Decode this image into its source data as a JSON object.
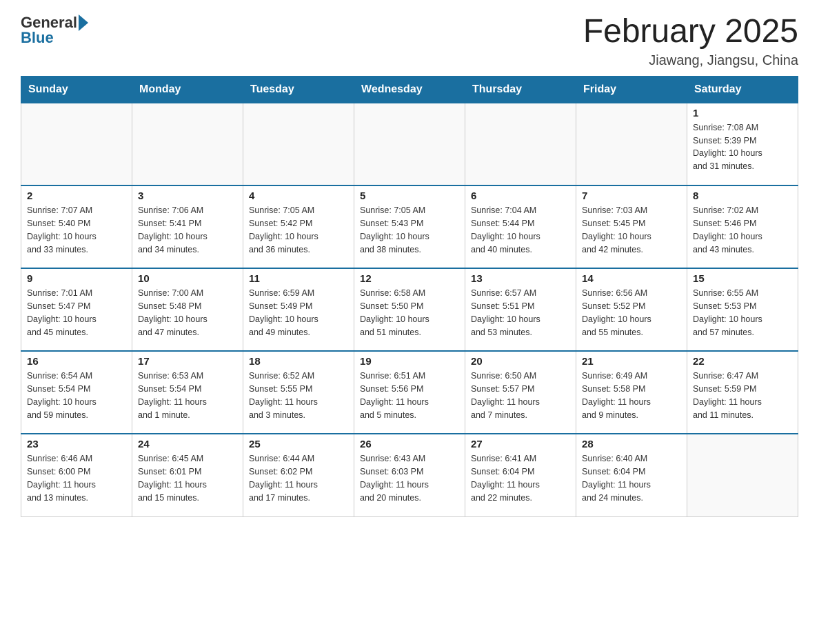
{
  "header": {
    "logo_general": "General",
    "logo_blue": "Blue",
    "title": "February 2025",
    "subtitle": "Jiawang, Jiangsu, China"
  },
  "weekdays": [
    "Sunday",
    "Monday",
    "Tuesday",
    "Wednesday",
    "Thursday",
    "Friday",
    "Saturday"
  ],
  "weeks": [
    [
      {
        "day": "",
        "info": ""
      },
      {
        "day": "",
        "info": ""
      },
      {
        "day": "",
        "info": ""
      },
      {
        "day": "",
        "info": ""
      },
      {
        "day": "",
        "info": ""
      },
      {
        "day": "",
        "info": ""
      },
      {
        "day": "1",
        "info": "Sunrise: 7:08 AM\nSunset: 5:39 PM\nDaylight: 10 hours\nand 31 minutes."
      }
    ],
    [
      {
        "day": "2",
        "info": "Sunrise: 7:07 AM\nSunset: 5:40 PM\nDaylight: 10 hours\nand 33 minutes."
      },
      {
        "day": "3",
        "info": "Sunrise: 7:06 AM\nSunset: 5:41 PM\nDaylight: 10 hours\nand 34 minutes."
      },
      {
        "day": "4",
        "info": "Sunrise: 7:05 AM\nSunset: 5:42 PM\nDaylight: 10 hours\nand 36 minutes."
      },
      {
        "day": "5",
        "info": "Sunrise: 7:05 AM\nSunset: 5:43 PM\nDaylight: 10 hours\nand 38 minutes."
      },
      {
        "day": "6",
        "info": "Sunrise: 7:04 AM\nSunset: 5:44 PM\nDaylight: 10 hours\nand 40 minutes."
      },
      {
        "day": "7",
        "info": "Sunrise: 7:03 AM\nSunset: 5:45 PM\nDaylight: 10 hours\nand 42 minutes."
      },
      {
        "day": "8",
        "info": "Sunrise: 7:02 AM\nSunset: 5:46 PM\nDaylight: 10 hours\nand 43 minutes."
      }
    ],
    [
      {
        "day": "9",
        "info": "Sunrise: 7:01 AM\nSunset: 5:47 PM\nDaylight: 10 hours\nand 45 minutes."
      },
      {
        "day": "10",
        "info": "Sunrise: 7:00 AM\nSunset: 5:48 PM\nDaylight: 10 hours\nand 47 minutes."
      },
      {
        "day": "11",
        "info": "Sunrise: 6:59 AM\nSunset: 5:49 PM\nDaylight: 10 hours\nand 49 minutes."
      },
      {
        "day": "12",
        "info": "Sunrise: 6:58 AM\nSunset: 5:50 PM\nDaylight: 10 hours\nand 51 minutes."
      },
      {
        "day": "13",
        "info": "Sunrise: 6:57 AM\nSunset: 5:51 PM\nDaylight: 10 hours\nand 53 minutes."
      },
      {
        "day": "14",
        "info": "Sunrise: 6:56 AM\nSunset: 5:52 PM\nDaylight: 10 hours\nand 55 minutes."
      },
      {
        "day": "15",
        "info": "Sunrise: 6:55 AM\nSunset: 5:53 PM\nDaylight: 10 hours\nand 57 minutes."
      }
    ],
    [
      {
        "day": "16",
        "info": "Sunrise: 6:54 AM\nSunset: 5:54 PM\nDaylight: 10 hours\nand 59 minutes."
      },
      {
        "day": "17",
        "info": "Sunrise: 6:53 AM\nSunset: 5:54 PM\nDaylight: 11 hours\nand 1 minute."
      },
      {
        "day": "18",
        "info": "Sunrise: 6:52 AM\nSunset: 5:55 PM\nDaylight: 11 hours\nand 3 minutes."
      },
      {
        "day": "19",
        "info": "Sunrise: 6:51 AM\nSunset: 5:56 PM\nDaylight: 11 hours\nand 5 minutes."
      },
      {
        "day": "20",
        "info": "Sunrise: 6:50 AM\nSunset: 5:57 PM\nDaylight: 11 hours\nand 7 minutes."
      },
      {
        "day": "21",
        "info": "Sunrise: 6:49 AM\nSunset: 5:58 PM\nDaylight: 11 hours\nand 9 minutes."
      },
      {
        "day": "22",
        "info": "Sunrise: 6:47 AM\nSunset: 5:59 PM\nDaylight: 11 hours\nand 11 minutes."
      }
    ],
    [
      {
        "day": "23",
        "info": "Sunrise: 6:46 AM\nSunset: 6:00 PM\nDaylight: 11 hours\nand 13 minutes."
      },
      {
        "day": "24",
        "info": "Sunrise: 6:45 AM\nSunset: 6:01 PM\nDaylight: 11 hours\nand 15 minutes."
      },
      {
        "day": "25",
        "info": "Sunrise: 6:44 AM\nSunset: 6:02 PM\nDaylight: 11 hours\nand 17 minutes."
      },
      {
        "day": "26",
        "info": "Sunrise: 6:43 AM\nSunset: 6:03 PM\nDaylight: 11 hours\nand 20 minutes."
      },
      {
        "day": "27",
        "info": "Sunrise: 6:41 AM\nSunset: 6:04 PM\nDaylight: 11 hours\nand 22 minutes."
      },
      {
        "day": "28",
        "info": "Sunrise: 6:40 AM\nSunset: 6:04 PM\nDaylight: 11 hours\nand 24 minutes."
      },
      {
        "day": "",
        "info": ""
      }
    ]
  ]
}
